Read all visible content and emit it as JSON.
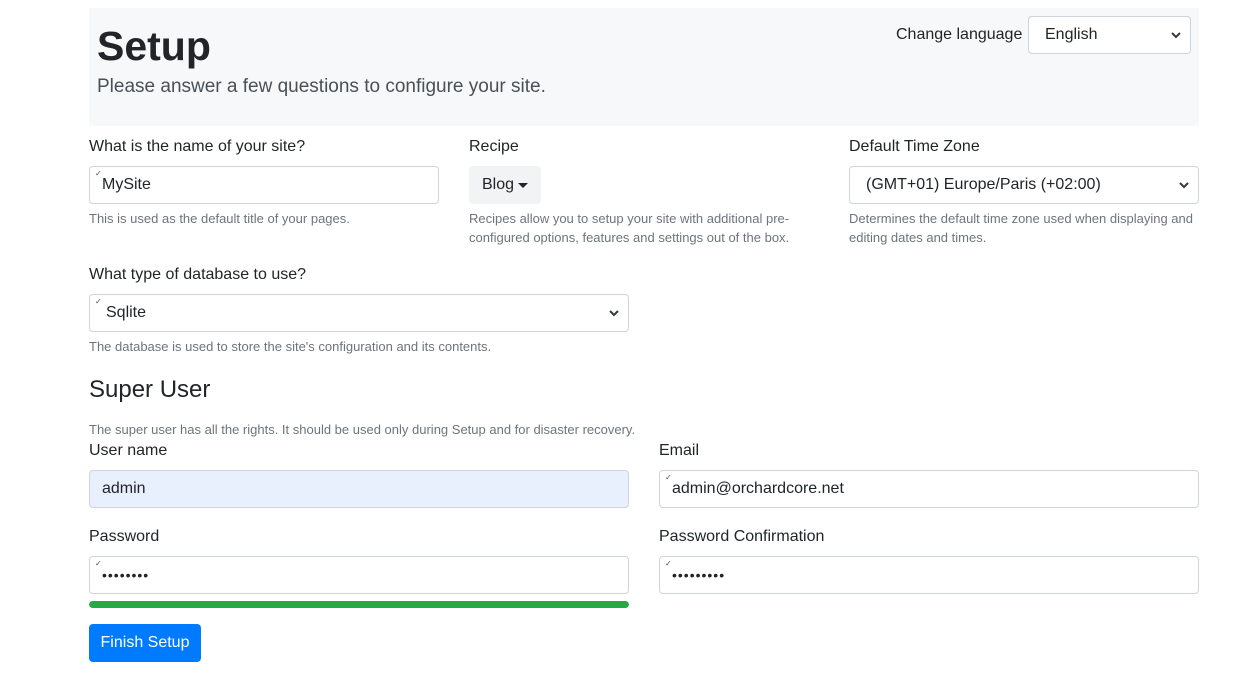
{
  "header": {
    "title": "Setup",
    "lead": "Please answer a few questions to configure your site.",
    "language_label": "Change language",
    "language_value": "English"
  },
  "site_name": {
    "label": "What is the name of your site?",
    "value": "MySite",
    "help": "This is used as the default title of your pages."
  },
  "recipe": {
    "label": "Recipe",
    "value": "Blog",
    "help": "Recipes allow you to setup your site with additional pre-configured options, features and settings out of the box."
  },
  "timezone": {
    "label": "Default Time Zone",
    "value": "(GMT+01) Europe/Paris (+02:00)",
    "help": "Determines the default time zone used when displaying and editing dates and times."
  },
  "database": {
    "label": "What type of database to use?",
    "value": "Sqlite",
    "help": "The database is used to store the site's configuration and its contents."
  },
  "super_user": {
    "title": "Super User",
    "help": "The super user has all the rights. It should be used only during Setup and for disaster recovery.",
    "username_label": "User name",
    "username_value": "admin",
    "email_label": "Email",
    "email_value": "admin@orchardcore.net",
    "password_label": "Password",
    "password_value": "••••••••",
    "password_confirm_label": "Password Confirmation",
    "password_confirm_value": "•••••••••",
    "password_strength": 1.0
  },
  "actions": {
    "finish_label": "Finish Setup"
  },
  "colors": {
    "primary": "#007bff",
    "strength": "#28a745",
    "autofill": "#e8f0fe"
  }
}
